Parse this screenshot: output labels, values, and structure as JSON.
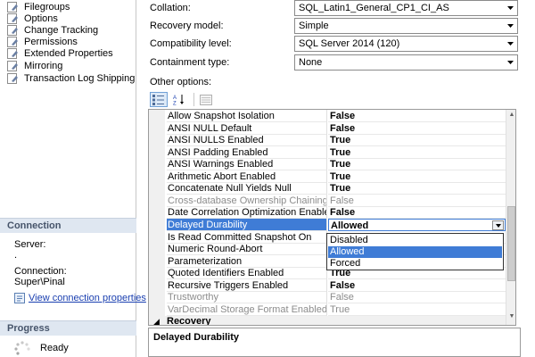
{
  "left_pane": {
    "pages": [
      "Filegroups",
      "Options",
      "Change Tracking",
      "Permissions",
      "Extended Properties",
      "Mirroring",
      "Transaction Log Shipping"
    ],
    "connection": {
      "header": "Connection",
      "server_label": "Server:",
      "server_value": ".",
      "connection_label": "Connection:",
      "connection_value": "Super\\Pinal",
      "view_link": "View connection properties"
    },
    "progress": {
      "header": "Progress",
      "status": "Ready"
    }
  },
  "form": {
    "collation": {
      "label": "Collation:",
      "value": "SQL_Latin1_General_CP1_CI_AS"
    },
    "recovery_model": {
      "label": "Recovery model:",
      "value": "Simple"
    },
    "compatibility_level": {
      "label": "Compatibility level:",
      "value": "SQL Server 2014 (120)"
    },
    "containment_type": {
      "label": "Containment type:",
      "value": "None"
    },
    "other_options_label": "Other options:"
  },
  "toolbar": {
    "categorized_icon": "categorized-icon",
    "alphabetical_icon": "alphabetical-icon",
    "property_pages_icon": "property-pages-icon"
  },
  "grid": {
    "rows": [
      {
        "name": "Allow Snapshot Isolation",
        "value": "False",
        "state": "normal"
      },
      {
        "name": "ANSI NULL Default",
        "value": "False",
        "state": "normal"
      },
      {
        "name": "ANSI NULLS Enabled",
        "value": "True",
        "state": "normal"
      },
      {
        "name": "ANSI Padding Enabled",
        "value": "True",
        "state": "normal"
      },
      {
        "name": "ANSI Warnings Enabled",
        "value": "True",
        "state": "normal"
      },
      {
        "name": "Arithmetic Abort Enabled",
        "value": "True",
        "state": "normal"
      },
      {
        "name": "Concatenate Null Yields Null",
        "value": "True",
        "state": "normal"
      },
      {
        "name": "Cross-database Ownership Chaining Enabled",
        "value": "False",
        "state": "disabled"
      },
      {
        "name": "Date Correlation Optimization Enabled",
        "value": "False",
        "state": "normal"
      },
      {
        "name": "Delayed Durability",
        "value": "Allowed",
        "state": "selected"
      },
      {
        "name": "Is Read Committed Snapshot On",
        "value": "",
        "state": "normal"
      },
      {
        "name": "Numeric Round-Abort",
        "value": "",
        "state": "normal"
      },
      {
        "name": "Parameterization",
        "value": "",
        "state": "normal"
      },
      {
        "name": "Quoted Identifiers Enabled",
        "value": "True",
        "state": "normal"
      },
      {
        "name": "Recursive Triggers Enabled",
        "value": "False",
        "state": "normal"
      },
      {
        "name": "Trustworthy",
        "value": "False",
        "state": "disabled"
      },
      {
        "name": "VarDecimal Storage Format Enabled",
        "value": "True",
        "state": "disabled"
      }
    ],
    "category": "Recovery"
  },
  "dropdown": {
    "options": [
      "Disabled",
      "Allowed",
      "Forced"
    ],
    "highlighted_index": 1
  },
  "description": {
    "title": "Delayed Durability"
  },
  "colors": {
    "selection": "#3f7cd6",
    "section_header_bg": "#dfe7f1",
    "link": "#1a3fb0"
  }
}
